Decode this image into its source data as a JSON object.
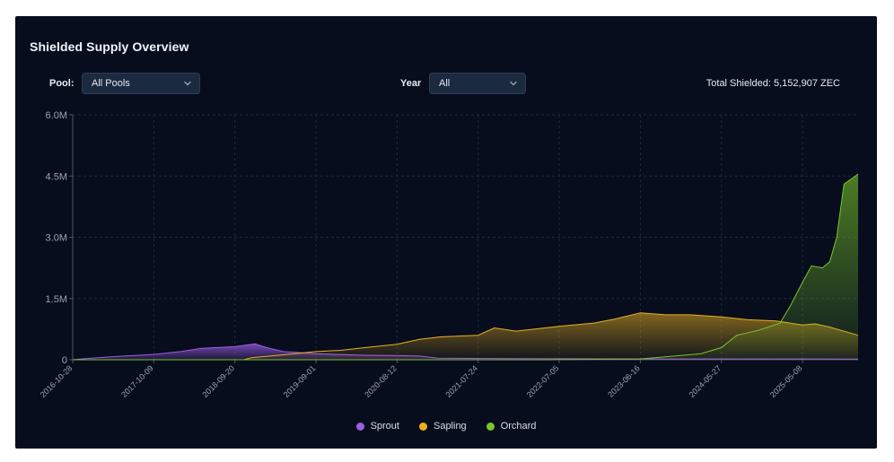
{
  "title": "Shielded Supply Overview",
  "filters": {
    "pool_label": "Pool:",
    "pool_value": "All Pools",
    "year_label": "Year",
    "year_value": "All"
  },
  "total": {
    "label": "Total Shielded:",
    "value": "5,152,907 ZEC"
  },
  "colors": {
    "sprout": "#9b5ce6",
    "sapling": "#e8b021",
    "orchard": "#7ac62a",
    "panel": "#070d1c"
  },
  "chart_data": {
    "type": "area",
    "title": "Shielded Supply Overview",
    "xlabel": "",
    "ylabel": "",
    "x_range": [
      "2016-10-28",
      "2025-12-31"
    ],
    "ylim": [
      0,
      6000000
    ],
    "y_ticks": [
      0,
      1500000,
      3000000,
      4500000,
      6000000
    ],
    "y_tick_labels": [
      "0",
      "1.5M",
      "3.0M",
      "4.5M",
      "6.0M"
    ],
    "x_ticks": [
      "2016-10-28",
      "2017-10-09",
      "2018-09-20",
      "2019-09-01",
      "2020-08-12",
      "2021-07-24",
      "2022-07-05",
      "2023-06-16",
      "2024-05-27",
      "2025-05-08"
    ],
    "grid": true,
    "legend": "bottom-center",
    "series": [
      {
        "name": "Sprout",
        "color_key": "sprout",
        "points": [
          [
            "2016-10-28",
            0
          ],
          [
            "2017-01-15",
            40000
          ],
          [
            "2017-05-01",
            80000
          ],
          [
            "2017-10-09",
            130000
          ],
          [
            "2018-02-01",
            200000
          ],
          [
            "2018-05-01",
            280000
          ],
          [
            "2018-09-20",
            320000
          ],
          [
            "2018-12-15",
            390000
          ],
          [
            "2019-02-01",
            300000
          ],
          [
            "2019-04-15",
            200000
          ],
          [
            "2019-09-01",
            150000
          ],
          [
            "2019-12-01",
            130000
          ],
          [
            "2020-04-01",
            110000
          ],
          [
            "2020-08-12",
            100000
          ],
          [
            "2020-11-15",
            90000
          ],
          [
            "2021-02-01",
            40000
          ],
          [
            "2021-07-24",
            30000
          ],
          [
            "2022-07-05",
            25000
          ],
          [
            "2023-06-16",
            20000
          ],
          [
            "2024-05-27",
            20000
          ],
          [
            "2025-05-08",
            20000
          ],
          [
            "2025-12-31",
            15000
          ]
        ]
      },
      {
        "name": "Sapling",
        "color_key": "sapling",
        "points": [
          [
            "2016-10-28",
            0
          ],
          [
            "2018-10-28",
            0
          ],
          [
            "2018-12-01",
            50000
          ],
          [
            "2019-04-15",
            120000
          ],
          [
            "2019-09-01",
            200000
          ],
          [
            "2019-12-15",
            230000
          ],
          [
            "2020-03-01",
            280000
          ],
          [
            "2020-08-12",
            380000
          ],
          [
            "2020-11-15",
            500000
          ],
          [
            "2021-02-15",
            560000
          ],
          [
            "2021-07-24",
            600000
          ],
          [
            "2021-10-01",
            780000
          ],
          [
            "2022-01-01",
            700000
          ],
          [
            "2022-07-05",
            820000
          ],
          [
            "2022-12-01",
            900000
          ],
          [
            "2023-03-01",
            1000000
          ],
          [
            "2023-06-16",
            1150000
          ],
          [
            "2023-10-01",
            1100000
          ],
          [
            "2024-01-15",
            1100000
          ],
          [
            "2024-05-27",
            1050000
          ],
          [
            "2024-09-15",
            980000
          ],
          [
            "2025-01-15",
            950000
          ],
          [
            "2025-05-08",
            850000
          ],
          [
            "2025-07-01",
            880000
          ],
          [
            "2025-09-01",
            800000
          ],
          [
            "2025-12-31",
            600000
          ]
        ]
      },
      {
        "name": "Orchard",
        "color_key": "orchard",
        "points": [
          [
            "2016-10-28",
            0
          ],
          [
            "2022-06-01",
            0
          ],
          [
            "2022-07-05",
            5000
          ],
          [
            "2023-06-16",
            20000
          ],
          [
            "2023-12-01",
            100000
          ],
          [
            "2024-03-01",
            150000
          ],
          [
            "2024-05-27",
            300000
          ],
          [
            "2024-08-01",
            600000
          ],
          [
            "2024-11-01",
            720000
          ],
          [
            "2025-02-01",
            900000
          ],
          [
            "2025-03-15",
            1300000
          ],
          [
            "2025-05-08",
            1900000
          ],
          [
            "2025-06-15",
            2300000
          ],
          [
            "2025-08-01",
            2250000
          ],
          [
            "2025-09-01",
            2400000
          ],
          [
            "2025-10-01",
            3000000
          ],
          [
            "2025-11-01",
            4300000
          ],
          [
            "2025-12-31",
            4550000
          ]
        ]
      }
    ]
  }
}
